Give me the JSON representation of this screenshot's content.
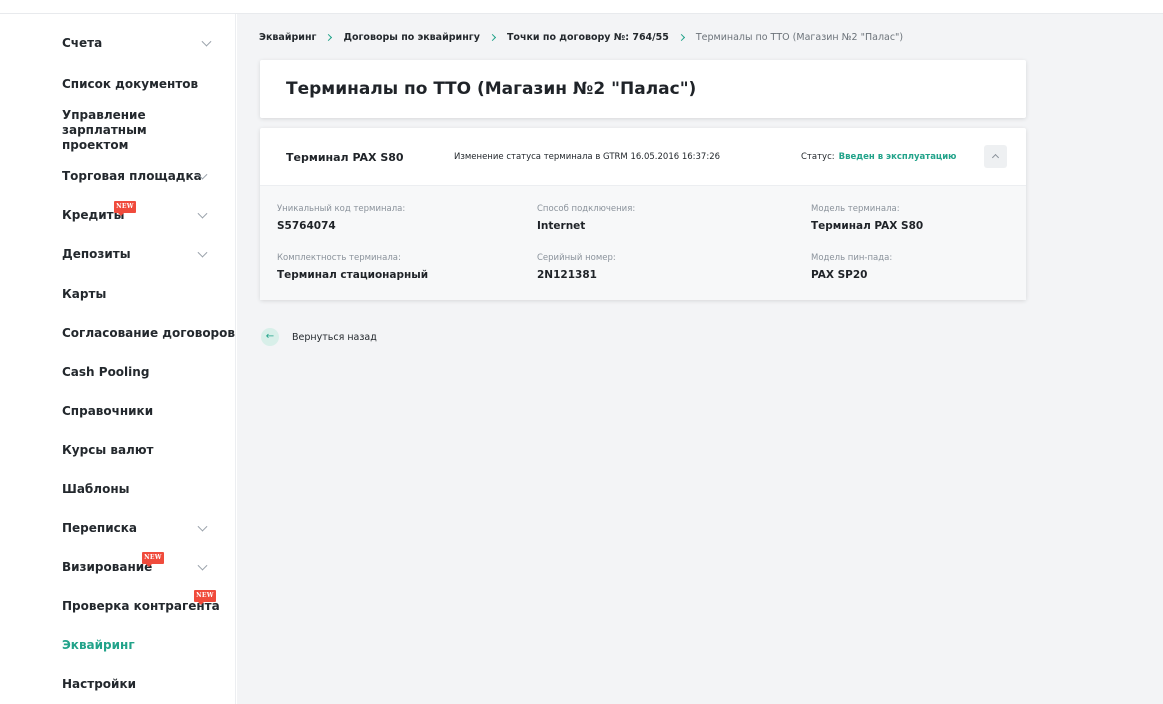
{
  "sidebar": {
    "items": [
      {
        "label": "Счета"
      },
      {
        "label": "Список документов"
      },
      {
        "label": "Управление зарплатным проектом"
      },
      {
        "label": "Торговая площадка"
      },
      {
        "label": "Кредиты",
        "badge": "NEW"
      },
      {
        "label": "Депозиты"
      },
      {
        "label": "Карты"
      },
      {
        "label": "Согласование договоров"
      },
      {
        "label": "Cash Pooling"
      },
      {
        "label": "Справочники"
      },
      {
        "label": "Курсы валют"
      },
      {
        "label": "Шаблоны"
      },
      {
        "label": "Переписка"
      },
      {
        "label": "Визирование",
        "badge": "NEW"
      },
      {
        "label": "Проверка контрагента",
        "badge": "NEW"
      },
      {
        "label": "Эквайринг"
      },
      {
        "label": "Настройки"
      }
    ]
  },
  "breadcrumb": [
    "Эквайринг",
    "Договоры по эквайрингу",
    "Точки по договору №: 764/55",
    "Терминалы по ТТО (Магазин №2 \"Палас\")"
  ],
  "page": {
    "title": "Терминалы по ТТО (Магазин №2 \"Палас\")"
  },
  "terminal": {
    "name": "Терминал PAX S80",
    "status_change": "Изменение статуса терминала в GTRM 16.05.2016 16:37:26",
    "status_label": "Статус:",
    "status_value": "Введен в эксплуатацию",
    "fields": [
      {
        "label": "Уникальный код терминала:",
        "value": "S5764074"
      },
      {
        "label": "Способ подключения:",
        "value": "Internet"
      },
      {
        "label": "Модель терминала:",
        "value": "Терминал PAX S80"
      },
      {
        "label": "Комплектность терминала:",
        "value": "Терминал стационарный"
      },
      {
        "label": "Серийный номер:",
        "value": "2N121381"
      },
      {
        "label": "Модель пин-пада:",
        "value": "PAX SP20"
      }
    ]
  },
  "back": {
    "label": "Вернуться назад",
    "arrow": "←"
  },
  "colors": {
    "accent": "#22a38a",
    "badge": "#f04b3c",
    "background": "#f3f4f6"
  }
}
